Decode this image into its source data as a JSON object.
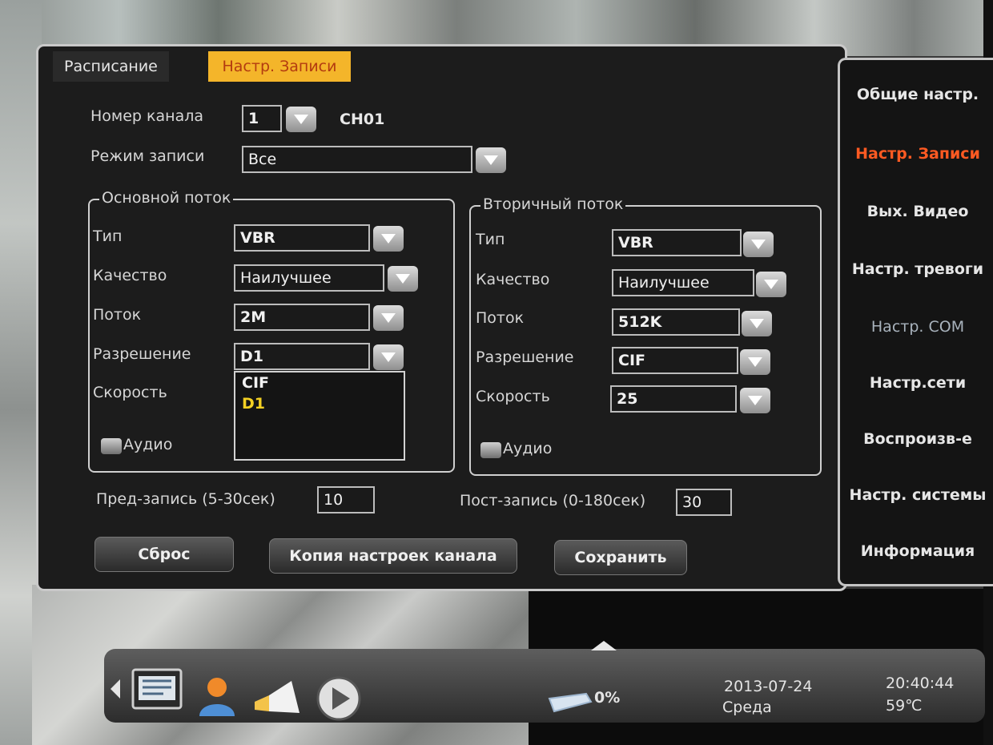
{
  "tabs": {
    "schedule": "Расписание",
    "record_settings": "Настр. Записи"
  },
  "channel": {
    "label": "Номер канала",
    "value": "1",
    "name": "CH01"
  },
  "record_mode": {
    "label": "Режим записи",
    "value": "Все"
  },
  "main_stream": {
    "title": "Основной поток",
    "type_label": "Тип",
    "type_value": "VBR",
    "quality_label": "Качество",
    "quality_value": "Наилучшее",
    "bitrate_label": "Поток",
    "bitrate_value": "2M",
    "resolution_label": "Разрешение",
    "resolution_value": "D1",
    "speed_label": "Скорость",
    "audio_label": "Аудио",
    "resolution_options": [
      "CIF",
      "D1"
    ]
  },
  "sub_stream": {
    "title": "Вторичный поток",
    "type_label": "Тип",
    "type_value": "VBR",
    "quality_label": "Качество",
    "quality_value": "Наилучшее",
    "bitrate_label": "Поток",
    "bitrate_value": "512K",
    "resolution_label": "Разрешение",
    "resolution_value": "CIF",
    "speed_label": "Скорость",
    "speed_value": "25",
    "audio_label": "Аудио"
  },
  "pre_record": {
    "label": "Пред-запись (5-30сек)",
    "value": "10"
  },
  "post_record": {
    "label": "Пост-запись (0-180сек)",
    "value": "30"
  },
  "buttons": {
    "reset": "Сброс",
    "copy": "Копия настроек канала",
    "save": "Сохранить"
  },
  "side_menu": {
    "general": "Общие настр.",
    "record": "Настр. Записи",
    "video_out": "Вых. Видео",
    "alarm": "Настр. тревоги",
    "com": "Настр. COM",
    "network": "Настр.сети",
    "playback": "Воспроизв-е",
    "system": "Настр. системы",
    "info": "Информация"
  },
  "taskbar": {
    "hdd_usage": "0%",
    "date": "2013-07-24",
    "weekday": "Среда",
    "time": "20:40:44",
    "temperature": "59℃"
  },
  "colors": {
    "active_tab": "#f4b52a",
    "active_menu": "#ff5a22",
    "selected_option": "#f3d023"
  }
}
